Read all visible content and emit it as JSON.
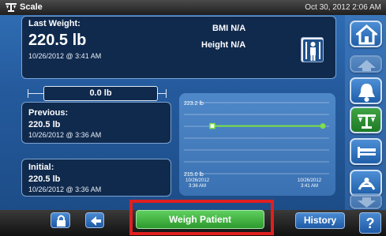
{
  "header": {
    "title": "Scale",
    "datetime": "Oct 30, 2012 2:06 AM"
  },
  "last_weight": {
    "label": "Last Weight:",
    "value": "220.5 lb",
    "timestamp": "10/26/2012 @ 3:41 AM",
    "bmi": "BMI N/A",
    "height": "Height N/A"
  },
  "difference": "0.0 lb",
  "previous": {
    "label": "Previous:",
    "value": "220.5 lb",
    "timestamp": "10/26/2012 @ 3:36 AM"
  },
  "initial": {
    "label": "Initial:",
    "value": "220.5 lb",
    "timestamp": "10/26/2012 @ 3:36 AM"
  },
  "chart_data": {
    "type": "line",
    "y_top_label": "223.2 lb",
    "y_bottom_label": "215.0 lb",
    "ylim": [
      215.0,
      223.2
    ],
    "x_labels": [
      {
        "date": "10/26/2012",
        "time": "3:36 AM"
      },
      {
        "date": "10/26/2012",
        "time": "3:41 AM"
      }
    ],
    "series": [
      {
        "values": [
          220.5,
          220.5
        ],
        "color": "#7be04a"
      }
    ],
    "grid": true
  },
  "bottom": {
    "weigh_label": "Weigh Patient",
    "history_label": "History",
    "help_label": "?"
  },
  "side_icons": [
    "home-icon",
    "up-arrow-icon",
    "bell-icon",
    "scale-icon",
    "bed-icon",
    "down-arrow-icon"
  ],
  "colors": {
    "accent_green": "#2c9a2c",
    "highlight_red": "#e01f1f",
    "panel": "#102a4d"
  }
}
